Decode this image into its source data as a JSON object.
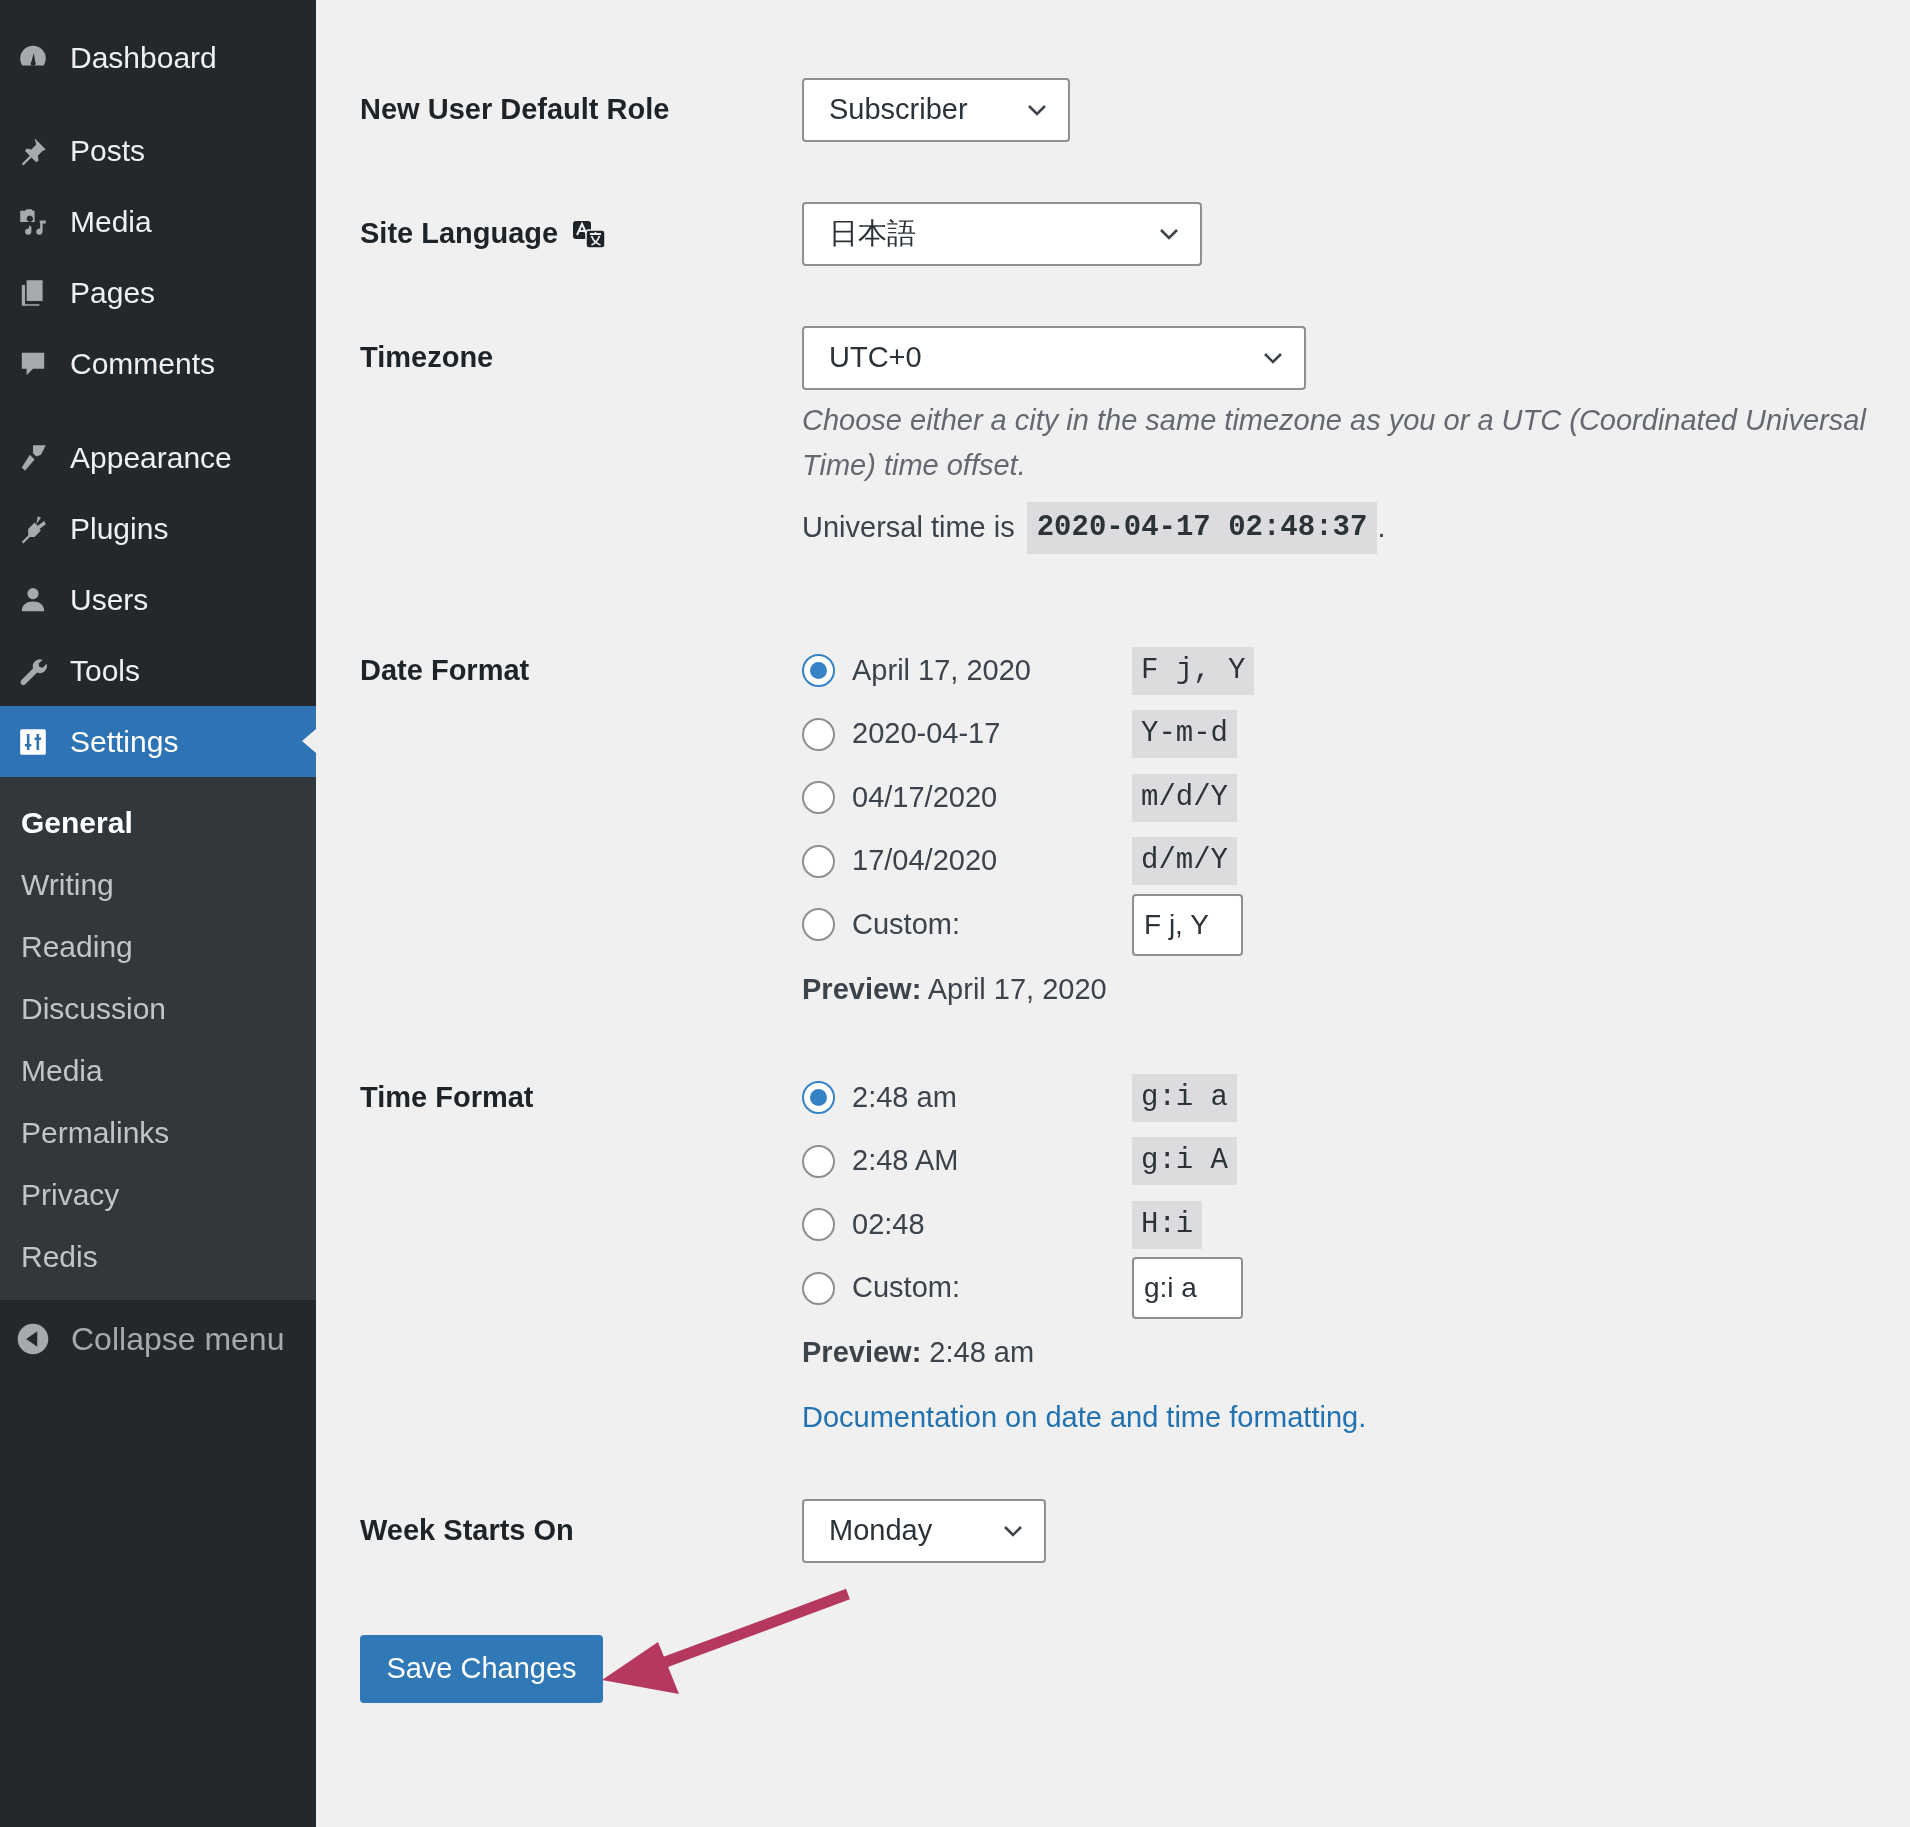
{
  "sidebar": {
    "items": [
      {
        "label": "Dashboard",
        "selected": false
      },
      {
        "label": "Posts",
        "selected": false
      },
      {
        "label": "Media",
        "selected": false
      },
      {
        "label": "Pages",
        "selected": false
      },
      {
        "label": "Comments",
        "selected": false
      },
      {
        "label": "Appearance",
        "selected": false
      },
      {
        "label": "Plugins",
        "selected": false
      },
      {
        "label": "Users",
        "selected": false
      },
      {
        "label": "Tools",
        "selected": false
      },
      {
        "label": "Settings",
        "selected": true
      }
    ],
    "submenu": [
      {
        "label": "General",
        "selected": true
      },
      {
        "label": "Writing",
        "selected": false
      },
      {
        "label": "Reading",
        "selected": false
      },
      {
        "label": "Discussion",
        "selected": false
      },
      {
        "label": "Media",
        "selected": false
      },
      {
        "label": "Permalinks",
        "selected": false
      },
      {
        "label": "Privacy",
        "selected": false
      },
      {
        "label": "Redis",
        "selected": false
      }
    ],
    "collapse": "Collapse menu"
  },
  "settings": {
    "default_role": {
      "label": "New User Default Role",
      "value": "Subscriber"
    },
    "site_language": {
      "label": "Site Language",
      "value": "日本語"
    },
    "timezone": {
      "label": "Timezone",
      "value": "UTC+0",
      "description": "Choose either a city in the same timezone as you or a UTC (Coordinated Universal Time) time offset.",
      "universal_label": "Universal time is",
      "universal_time": "2020-04-17 02:48:37",
      "universal_end": "."
    },
    "date_format": {
      "label": "Date Format",
      "options": [
        {
          "kind": "preset",
          "label": "April 17, 2020",
          "code": "F j, Y",
          "selected": true
        },
        {
          "kind": "preset",
          "label": "2020-04-17",
          "code": "Y-m-d",
          "selected": false
        },
        {
          "kind": "preset",
          "label": "04/17/2020",
          "code": "m/d/Y",
          "selected": false
        },
        {
          "kind": "preset",
          "label": "17/04/2020",
          "code": "d/m/Y",
          "selected": false
        },
        {
          "kind": "custom",
          "label": "Custom:",
          "value": "F j, Y",
          "selected": false
        }
      ],
      "preview_label": "Preview:",
      "preview": "April 17, 2020"
    },
    "time_format": {
      "label": "Time Format",
      "options": [
        {
          "kind": "preset",
          "label": "2:48 am",
          "code": "g:i a",
          "selected": true
        },
        {
          "kind": "preset",
          "label": "2:48 AM",
          "code": "g:i A",
          "selected": false
        },
        {
          "kind": "preset",
          "label": "02:48",
          "code": "H:i",
          "selected": false
        },
        {
          "kind": "custom",
          "label": "Custom:",
          "value": "g:i a",
          "selected": false
        }
      ],
      "preview_label": "Preview:",
      "preview": "2:48 am"
    },
    "doc_link": "Documentation on date and time formatting.",
    "week_start": {
      "label": "Week Starts On",
      "value": "Monday"
    },
    "save_button": "Save Changes"
  }
}
